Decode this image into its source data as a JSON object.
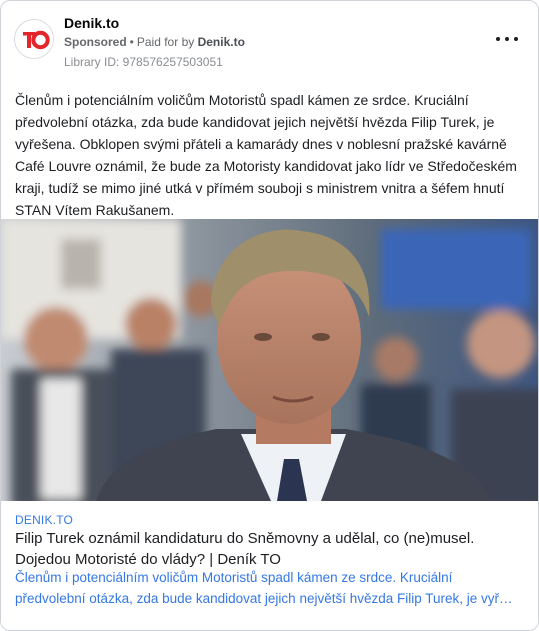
{
  "header": {
    "page_name": "Denik.to",
    "sponsored": "Sponsored",
    "separator": "•",
    "paid_for_by": "Paid for by",
    "paid_name": "Denik.to",
    "library_id": "Library ID: 978576257503051",
    "avatar_logo": "TO"
  },
  "post": {
    "text": "Členům i potenciálním voličům Motoristů spadl kámen ze srdce. Kruciální předvolební otázka, zda bude kandidovat jejich největší hvězda Filip Turek, je vyřešena. Obklopen svými přáteli a kamarády dnes v noblesní pražské kavárně Café Louvre oznámil, že bude za Motoristy kandidovat jako lídr ve Středočeském kraji, tudíž se mimo jiné utká v přímém souboji s ministrem vnitra a šéfem hnutí STAN Vítem Rakušanem."
  },
  "link": {
    "domain": "DENIK.TO",
    "title": "Filip Turek oznámil kandidaturu do Sněmovny a udělal, co (ne)musel. Dojedou Motoristé do vlády? | Deník TO",
    "desc_line1": "Členům i potenciálním voličům Motoristů spadl kámen ze srdce. Kruciální",
    "desc_line2": "předvolební otázka, zda bude kandidovat jejich největší hvězda Filip Turek, je vyřešena."
  },
  "colors": {
    "link_blue": "#3578e5",
    "logo_red": "#e3262a"
  },
  "icons": {
    "more": "more-horizontal-icon",
    "avatar": "denik-to-logo"
  }
}
